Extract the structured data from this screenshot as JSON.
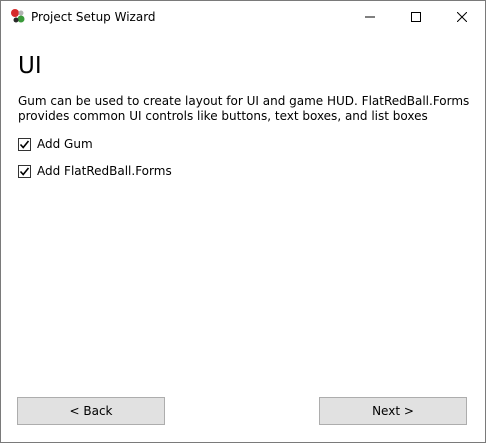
{
  "window": {
    "title": "Project Setup Wizard"
  },
  "page": {
    "heading": "UI",
    "description": "Gum can be used to create layout for UI and game HUD. FlatRedBall.Forms provides common UI controls like buttons, text boxes, and list boxes"
  },
  "options": [
    {
      "label": "Add Gum",
      "checked": true
    },
    {
      "label": "Add FlatRedBall.Forms",
      "checked": true
    }
  ],
  "footer": {
    "back_label": "< Back",
    "next_label": "Next >"
  },
  "icons": {
    "app": "app-icon",
    "minimize": "minimize-icon",
    "maximize": "maximize-icon",
    "close": "close-icon",
    "check": "checkmark-icon"
  },
  "colors": {
    "button_face": "#e1e1e1",
    "button_border": "#adadad",
    "icon_red": "#d62a2a",
    "icon_green": "#3a9a3a"
  }
}
